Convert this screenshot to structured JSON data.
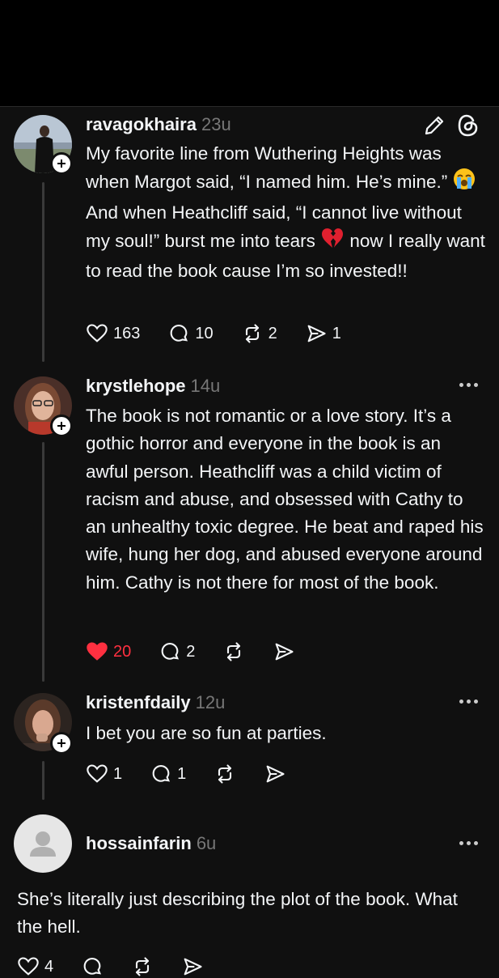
{
  "comments": [
    {
      "username": "ravagokhaira",
      "time": "23u",
      "text_parts": [
        "My favorite line from Wuthering Heights was when Margot said, “I named him. He’s mine.” ",
        " And when Heathcliff said, “I cannot live without my soul!” burst me into tears ",
        " now I really want to read the book cause I’m so invested!!"
      ],
      "emojis": [
        "loudly-crying-face-emoji",
        "broken-heart-emoji"
      ],
      "likes": "163",
      "replies": "10",
      "reposts": "2",
      "shares": "1",
      "liked": false
    },
    {
      "username": "krystlehope",
      "time": "14u",
      "text": "The book is not romantic or a love story. It’s a gothic horror and everyone in the book is an awful person. Heathcliff was a child victim of racism and abuse, and obsessed with Cathy to an unhealthy toxic degree. He beat and raped his wife, hung her dog, and abused everyone around him. Cathy is not there for most of the book.",
      "likes": "20",
      "replies": "2",
      "liked": true
    },
    {
      "username": "kristenfdaily",
      "time": "12u",
      "text": "I bet you are so fun at parties.",
      "likes": "1",
      "replies": "1",
      "liked": false
    },
    {
      "username": "hossainfarin",
      "time": "6u",
      "text": "She’s literally just describing the plot of the book. What the hell.",
      "likes": "4",
      "liked": false
    }
  ],
  "colors": {
    "background": "#101010",
    "liked": "#ff3040",
    "secondary_text": "#777777"
  }
}
